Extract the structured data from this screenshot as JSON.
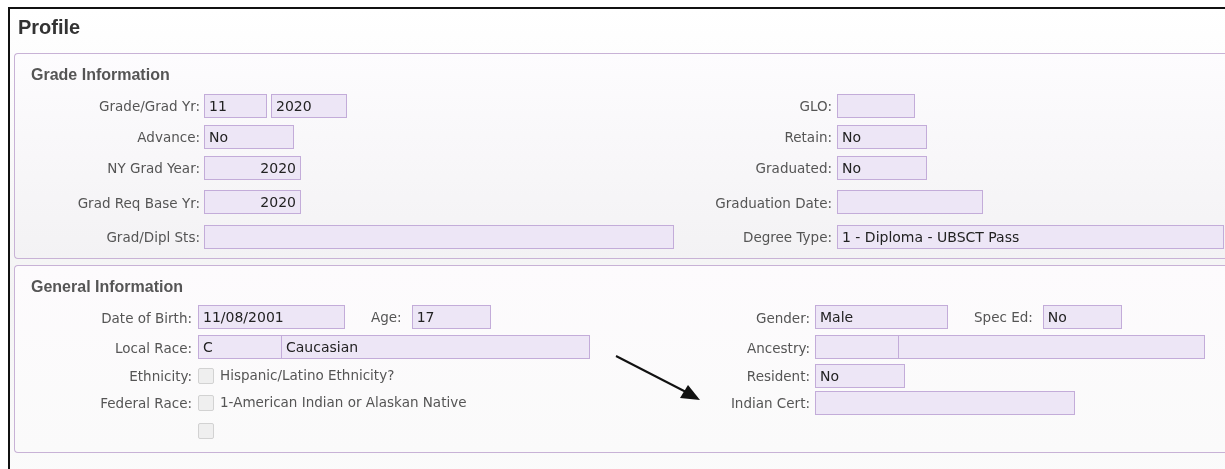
{
  "title": "Profile",
  "sections": [
    {
      "title": "Grade Information",
      "rows": [
        {
          "left": [
            {
              "kind": "label",
              "text": "Grade/Grad Yr:"
            },
            {
              "kind": "field",
              "value": "11"
            },
            {
              "kind": "field",
              "value": "2020"
            }
          ],
          "right": [
            {
              "kind": "label",
              "text": "GLO:"
            },
            {
              "kind": "field"
            }
          ]
        },
        {
          "left": [
            {
              "kind": "label",
              "text": "Advance:"
            },
            {
              "kind": "field",
              "value": "No"
            }
          ],
          "right": [
            {
              "kind": "label",
              "text": "Retain:"
            },
            {
              "kind": "field",
              "value": "No"
            }
          ]
        },
        {
          "left": [
            {
              "kind": "label",
              "text": "NY Grad Year:"
            },
            {
              "kind": "numeric",
              "value": "2020"
            }
          ],
          "right": [
            {
              "kind": "label",
              "text": "Graduated:"
            },
            {
              "kind": "field",
              "value": "No"
            }
          ]
        },
        {
          "left": [
            {
              "kind": "label",
              "text": "Grad Req Base Yr:"
            },
            {
              "kind": "numeric",
              "value": "2020"
            }
          ],
          "right": [
            {
              "kind": "label",
              "text": "Graduation Date:"
            },
            {
              "kind": "field"
            }
          ]
        },
        {
          "left": [
            {
              "kind": "label",
              "text": "Grad/Dipl Sts:"
            },
            {
              "kind": "field"
            }
          ],
          "right": [
            {
              "kind": "label",
              "text": "Degree Type:"
            },
            {
              "kind": "field",
              "value": "1 - Diploma - UBSCT Pass"
            }
          ]
        }
      ]
    },
    {
      "title": "General Information",
      "rows": [
        {
          "left": [
            {
              "kind": "label",
              "text": "Date of Birth:"
            },
            {
              "kind": "field",
              "value": "11/08/2001"
            },
            {
              "kind": "label",
              "text": "Age:"
            },
            {
              "kind": "field",
              "value": "17"
            }
          ],
          "right": [
            {
              "kind": "label",
              "text": "Gender:"
            },
            {
              "kind": "field",
              "value": "Male"
            },
            {
              "kind": "label",
              "text": "Spec Ed:"
            },
            {
              "kind": "field",
              "value": "No"
            }
          ]
        },
        {
          "left": [
            {
              "kind": "label",
              "text": "Local Race:"
            },
            {
              "kind": "split",
              "cells": [
                {
                  "value": "C"
                },
                {
                  "value": "Caucasian"
                }
              ]
            }
          ],
          "right": [
            {
              "kind": "label",
              "text": "Ancestry:"
            },
            {
              "kind": "split",
              "cells": [
                {},
                {}
              ]
            }
          ]
        },
        {
          "left": [
            {
              "kind": "label",
              "text": "Ethnicity:"
            },
            {
              "kind": "checkbox",
              "checked": false,
              "text": "Hispanic/Latino Ethnicity?"
            }
          ],
          "right": [
            {
              "kind": "label",
              "text": "Resident:"
            },
            {
              "kind": "field",
              "value": "No"
            }
          ]
        },
        {
          "left": [
            {
              "kind": "label",
              "text": "Federal Race:"
            },
            {
              "kind": "checkbox",
              "checked": false,
              "text": "1-American Indian or Alaskan Native"
            }
          ],
          "right": [
            {
              "kind": "label",
              "text": "Indian Cert:"
            },
            {
              "kind": "field"
            }
          ]
        },
        {
          "left": [
            {
              "kind": "spacer"
            },
            {
              "kind": "checkbox",
              "checked": false
            }
          ],
          "right": []
        }
      ]
    }
  ]
}
